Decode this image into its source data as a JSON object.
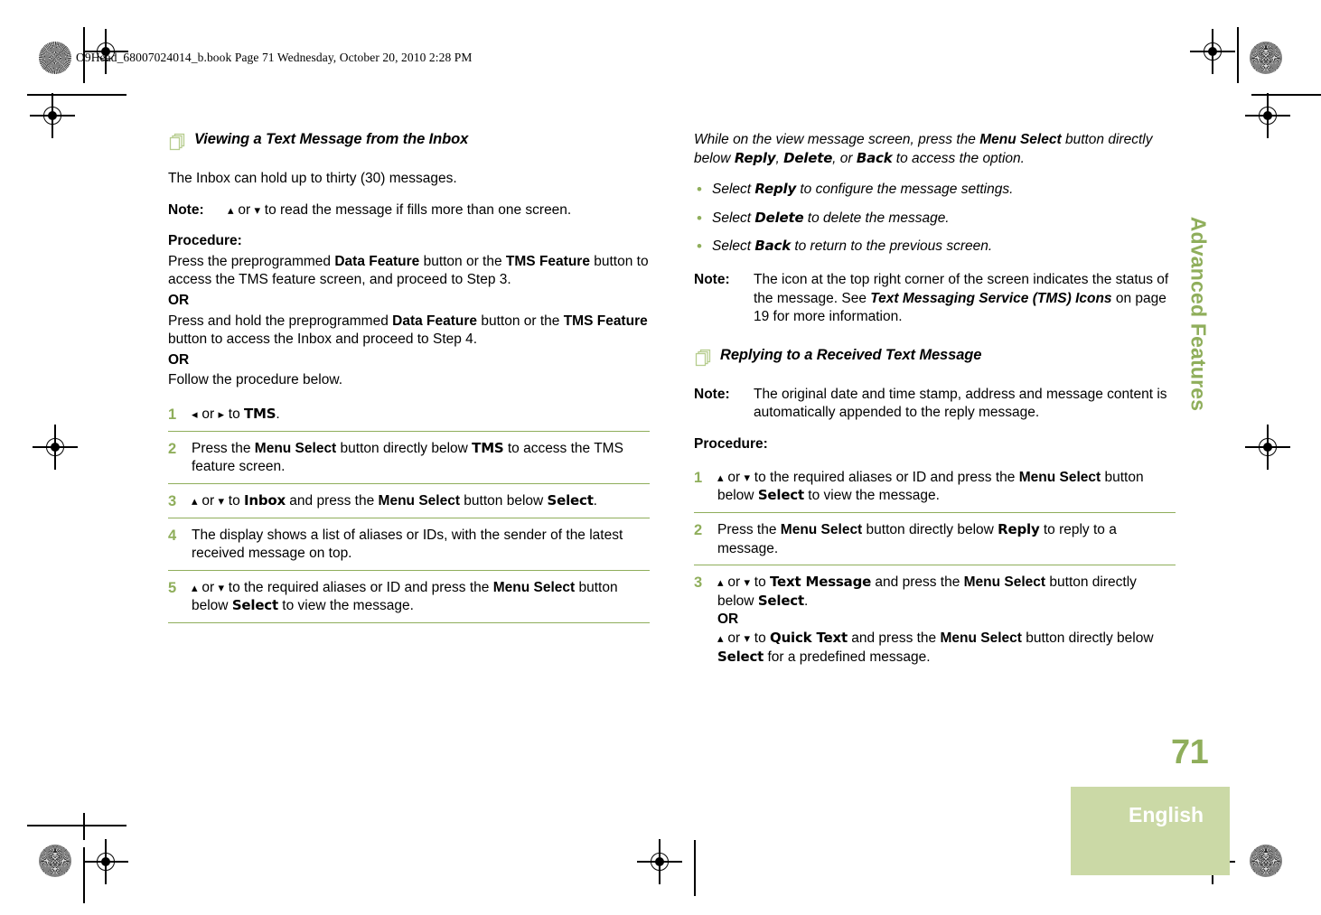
{
  "file_header": "O9Head_68007024014_b.book  Page 71  Wednesday, October 20, 2010  2:28 PM",
  "colors": {
    "accent_green": "#8FAE5B",
    "tab_green": "#CBD9A6",
    "icon_green": "#B6CC8E",
    "text": "#000000"
  },
  "chapter_tab": {
    "label": "Advanced Features"
  },
  "page_number": "71",
  "language_tab": {
    "label": "English"
  },
  "left_column": {
    "heading": "Viewing a Text Message from the Inbox",
    "heading_icon": "stacked-pages-icon",
    "intro": "The Inbox can hold up to thirty (30) messages.",
    "note": {
      "label": "Note:",
      "body_parts": [
        {
          "type": "arrow",
          "text": "▴"
        },
        {
          "type": "plain",
          "text": " or "
        },
        {
          "type": "arrow",
          "text": "▾"
        },
        {
          "type": "plain",
          "text": " to read the message if fills more than one screen."
        }
      ]
    },
    "procedure_label": "Procedure:",
    "procedure_intro": [
      {
        "line": "Press the preprogrammed Data Feature button or the TMS Feature button to access the TMS feature screen, and proceed to Step 3."
      },
      {
        "line": "OR"
      },
      {
        "line": "Press and hold the preprogrammed Data Feature button or the TMS Feature button to access the Inbox and proceed to Step 4."
      },
      {
        "line": "OR"
      },
      {
        "line": "Follow the procedure below."
      }
    ],
    "steps": [
      {
        "num": "1",
        "text": "◂ or ▸ to TMS."
      },
      {
        "num": "2",
        "text": "Press the Menu Select button directly below TMS to access the TMS feature screen."
      },
      {
        "num": "3",
        "text": "▴ or ▾ to Inbox and press the Menu Select button below Select."
      },
      {
        "num": "4",
        "text": "The display shows a list of aliases or IDs, with the sender of the latest received message on top."
      },
      {
        "num": "5",
        "text": "▴ or ▾ to the required aliases or ID and press the Menu Select button below Select to view the message."
      }
    ]
  },
  "right_column": {
    "intro_italic": "While on the view message screen, press the Menu Select button directly below Reply, Delete, or Back to access the option.",
    "bullets": [
      "Select Reply to configure the message settings.",
      "Select Delete to delete the message.",
      "Select Back to return to the previous screen."
    ],
    "note_icon": {
      "label": "Note:",
      "body": "The icon at the top right corner of the screen indicates the status of the message. See Text Messaging Service (TMS) Icons on page 19 for more information.",
      "cross_reference": "Text Messaging Service (TMS) Icons",
      "cross_reference_page": "19"
    },
    "heading": "Replying to a Received Text Message",
    "heading_icon": "stacked-pages-icon",
    "note_reply": {
      "label": "Note:",
      "body": "The original date and time stamp, address and message content is automatically appended to the reply message."
    },
    "procedure_label": "Procedure:",
    "steps": [
      {
        "num": "1",
        "text": "▴ or ▾ to the required aliases or ID and press the Menu Select button below Select to view the message."
      },
      {
        "num": "2",
        "text": "Press the Menu Select button directly below Reply to reply to a message."
      },
      {
        "num": "3",
        "text": "▴ or ▾ to Text Message and press the Menu Select button directly below Select. OR ▴ or ▾ to Quick Text and press the Menu Select button directly below Select for a predefined message."
      }
    ]
  },
  "registration_marks": {
    "rosette_icon": "halftone-rosette-icon",
    "target_icon": "registration-target-icon",
    "count": 8
  }
}
